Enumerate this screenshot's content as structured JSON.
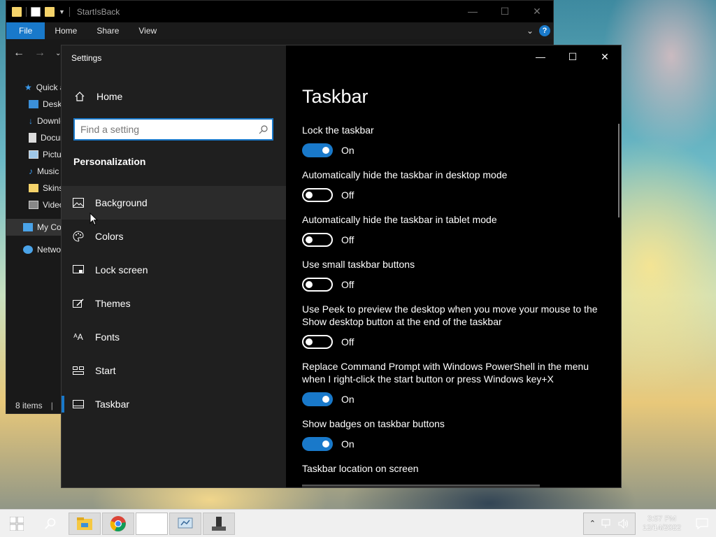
{
  "explorer": {
    "title": "StartIsBack",
    "ribbon_tabs": [
      "File",
      "Home",
      "Share",
      "View"
    ],
    "tree": [
      {
        "label": "Quick access",
        "icon": "star-icon"
      },
      {
        "label": "Desktop",
        "icon": "desktop-folder-icon"
      },
      {
        "label": "Downloads",
        "icon": "downloads-icon"
      },
      {
        "label": "Documents",
        "icon": "documents-icon"
      },
      {
        "label": "Pictures",
        "icon": "pictures-icon"
      },
      {
        "label": "Music",
        "icon": "music-icon"
      },
      {
        "label": "Skins",
        "icon": "folder-icon"
      },
      {
        "label": "Videos",
        "icon": "videos-icon"
      },
      {
        "label": "My Computer",
        "icon": "computer-icon"
      },
      {
        "label": "Network",
        "icon": "network-icon"
      }
    ],
    "status": "8 items"
  },
  "settings": {
    "window_title": "Settings",
    "home_label": "Home",
    "search_placeholder": "Find a setting",
    "section": "Personalization",
    "nav": [
      {
        "label": "Background",
        "icon": "picture-icon"
      },
      {
        "label": "Colors",
        "icon": "palette-icon"
      },
      {
        "label": "Lock screen",
        "icon": "lock-screen-icon"
      },
      {
        "label": "Themes",
        "icon": "themes-icon"
      },
      {
        "label": "Fonts",
        "icon": "fonts-icon"
      },
      {
        "label": "Start",
        "icon": "start-icon"
      },
      {
        "label": "Taskbar",
        "icon": "taskbar-icon"
      }
    ],
    "page_title": "Taskbar",
    "options": [
      {
        "label": "Lock the taskbar",
        "state": "On"
      },
      {
        "label": "Automatically hide the taskbar in desktop mode",
        "state": "Off"
      },
      {
        "label": "Automatically hide the taskbar in tablet mode",
        "state": "Off"
      },
      {
        "label": "Use small taskbar buttons",
        "state": "Off"
      },
      {
        "label": "Use Peek to preview the desktop when you move your mouse to the Show desktop button at the end of the taskbar",
        "state": "Off"
      },
      {
        "label": "Replace Command Prompt with Windows PowerShell in the menu when I right-click the start button or press Windows key+X",
        "state": "On"
      },
      {
        "label": "Show badges on taskbar buttons",
        "state": "On"
      }
    ],
    "location_label": "Taskbar location on screen"
  },
  "taskbar": {
    "time": "3:57 PM",
    "date": "12/14/2022"
  },
  "colors": {
    "accent": "#1979ca",
    "sidebar_bg": "#1f1f1f",
    "content_bg": "#000000"
  }
}
